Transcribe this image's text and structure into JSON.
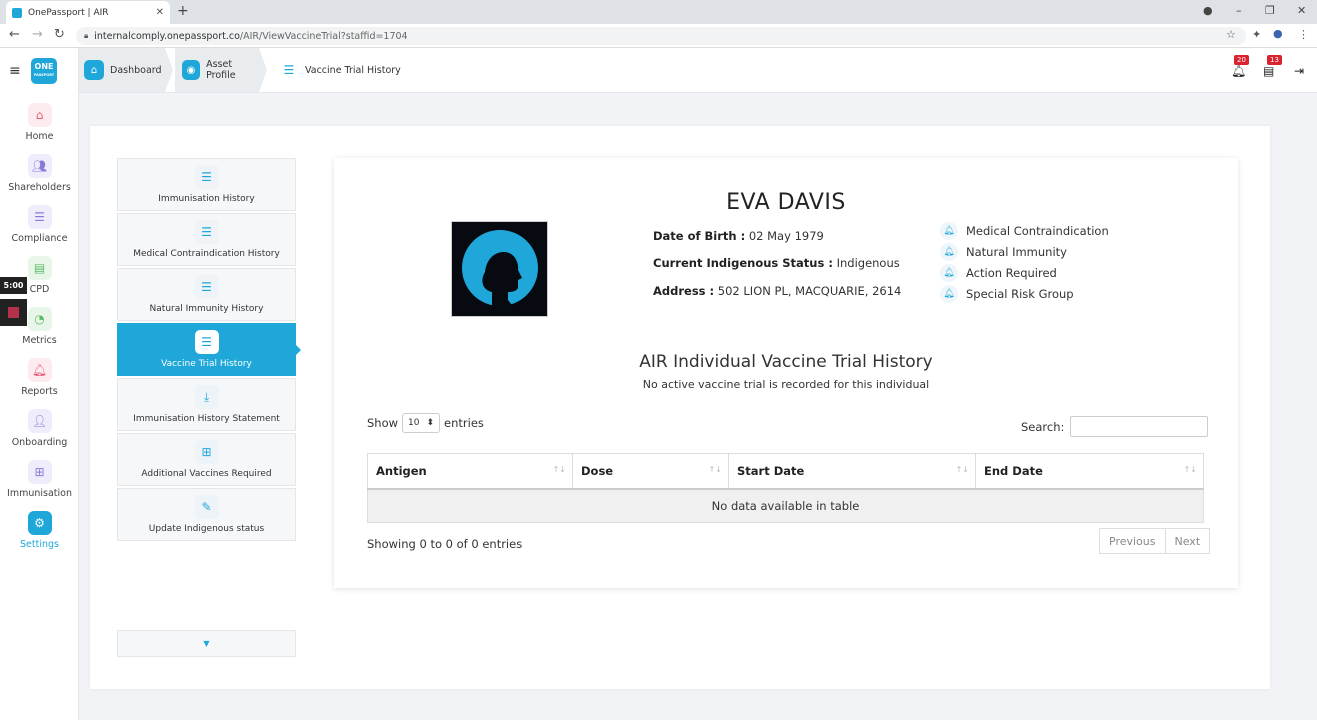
{
  "browser": {
    "tab_title": "OnePassport | AIR",
    "close_tab": "✕",
    "new_tab": "+",
    "url_host": "internalcomply.onepassport.co",
    "url_path": "/AIR/ViewVaccineTrial?staffid=1704"
  },
  "sidebar": {
    "logo_text": "ONE",
    "logo_sub": "PASSPORT",
    "items": [
      {
        "label": "Home"
      },
      {
        "label": "Shareholders"
      },
      {
        "label": "Compliance"
      },
      {
        "label": "CPD"
      },
      {
        "label": "Metrics"
      },
      {
        "label": "Reports"
      },
      {
        "label": "Onboarding"
      },
      {
        "label": "Immunisation"
      },
      {
        "label": "Settings"
      }
    ],
    "timer": "5:00"
  },
  "header": {
    "breadcrumbs": [
      "Dashboard",
      "Asset Profile",
      "Vaccine Trial History"
    ],
    "notifications_count": "20",
    "tasks_count": "13"
  },
  "menu": {
    "items": [
      {
        "label": "Immunisation History"
      },
      {
        "label": "Medical Contraindication History"
      },
      {
        "label": "Natural Immunity History"
      },
      {
        "label": "Vaccine Trial History"
      },
      {
        "label": "Immunisation History Statement"
      },
      {
        "label": "Additional Vaccines Required"
      },
      {
        "label": "Update Indigenous status"
      }
    ]
  },
  "profile": {
    "name": "EVA DAVIS",
    "dob_label": "Date of Birth :",
    "dob_value": "02 May 1979",
    "indigenous_label": "Current Indigenous Status :",
    "indigenous_value": "Indigenous",
    "address_label": "Address :",
    "address_value": "502 LION PL, MACQUARIE, 2614",
    "flags": [
      "Medical Contraindication",
      "Natural Immunity",
      "Action Required",
      "Special Risk Group"
    ]
  },
  "section": {
    "title": "AIR Individual Vaccine Trial History",
    "subtitle": "No active vaccine trial is recorded for this individual"
  },
  "table": {
    "show_label": "Show",
    "page_size": "10",
    "entries_label": "entries",
    "search_label": "Search:",
    "columns": [
      "Antigen",
      "Dose",
      "Start Date",
      "End Date"
    ],
    "empty_message": "No data available in table",
    "info": "Showing 0 to 0 of 0 entries",
    "prev": "Previous",
    "next": "Next"
  },
  "colors": {
    "accent": "#1ea7d8",
    "badge": "#d9232d"
  }
}
